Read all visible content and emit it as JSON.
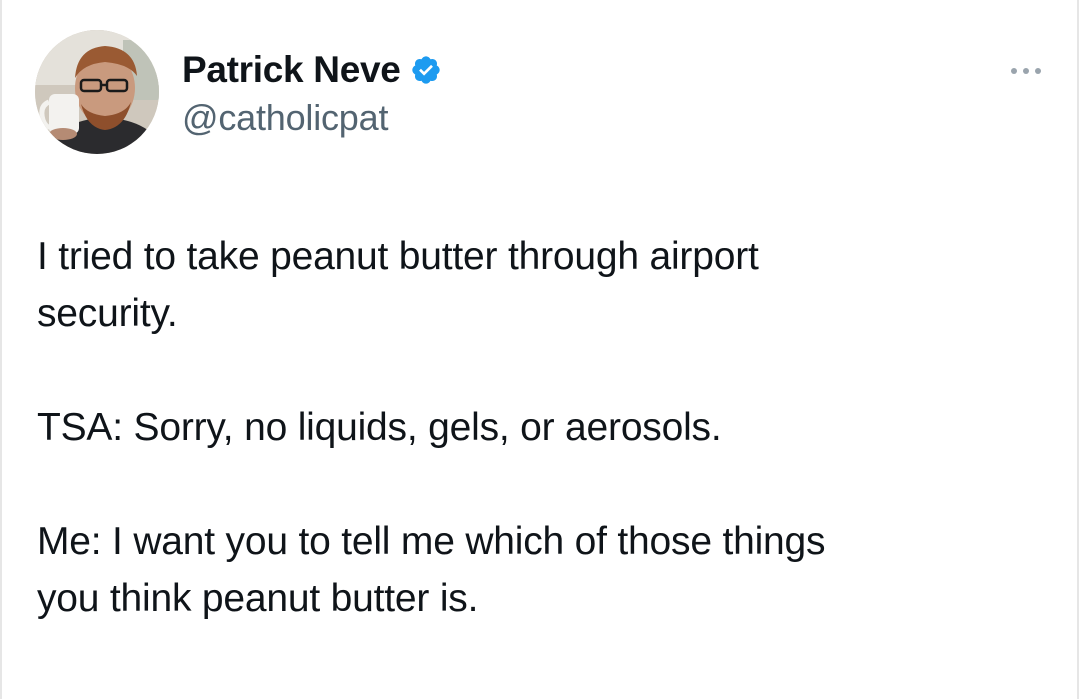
{
  "author": {
    "display_name": "Patrick Neve",
    "handle": "@catholicpat",
    "verified": true,
    "verified_color": "#1d9bf0",
    "avatar_icon": "avatar-photo"
  },
  "menu": {
    "icon": "more-dots-icon"
  },
  "tweet": {
    "paragraphs": [
      "I tried to take peanut butter through airport\nsecurity.",
      "TSA: Sorry, no liquids, gels, or aerosols.",
      "Me: I want you to tell me which of those things\nyou think peanut butter is."
    ]
  }
}
